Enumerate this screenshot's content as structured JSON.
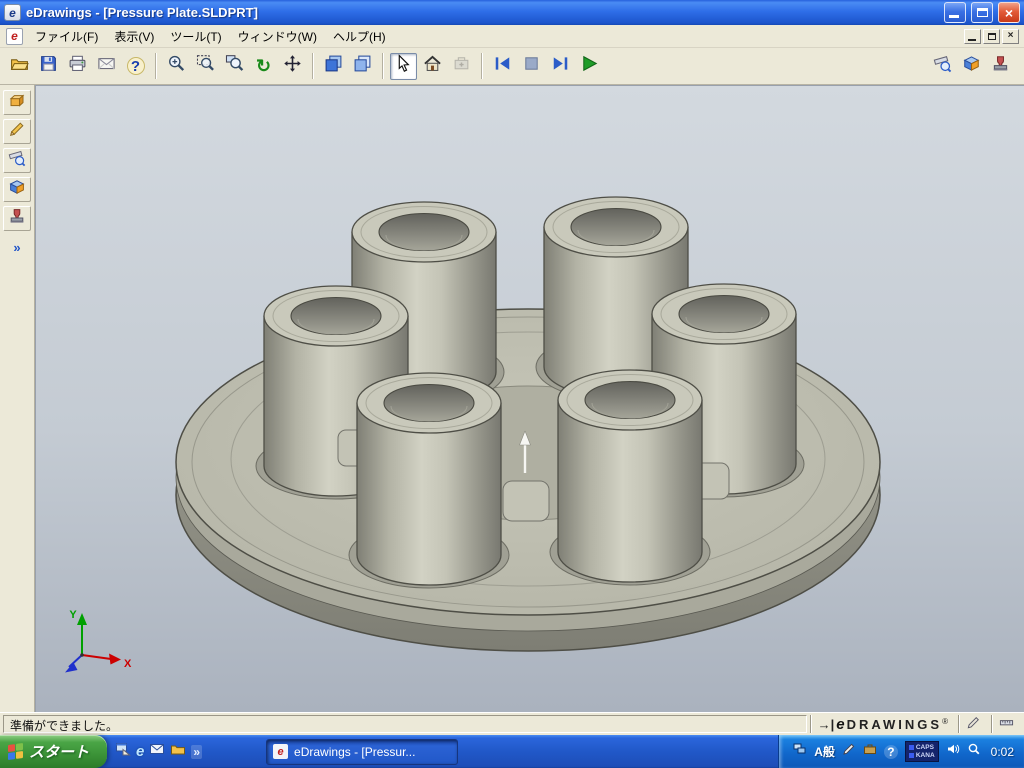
{
  "window": {
    "title": "eDrawings - [Pressure Plate.SLDPRT]"
  },
  "menubar": {
    "items": [
      {
        "label": "ファイル(F)"
      },
      {
        "label": "表示(V)"
      },
      {
        "label": "ツール(T)"
      },
      {
        "label": "ウィンドウ(W)"
      },
      {
        "label": "ヘルプ(H)"
      }
    ]
  },
  "toolbar": {
    "buttons": [
      "open",
      "save",
      "print",
      "send-email",
      "help",
      "zoom",
      "zoom-to-fit",
      "zoom-area",
      "rotate",
      "pan",
      "shaded-view",
      "wireframe-view",
      "select",
      "home-view",
      "move-component",
      "previous-view",
      "stop-animation",
      "next-view",
      "play-animation",
      "measure",
      "section",
      "stamp"
    ]
  },
  "sidebar": {
    "buttons": [
      "components",
      "markup",
      "measure",
      "section",
      "stamp",
      "expand"
    ]
  },
  "viewport": {
    "triad": {
      "x_label": "X",
      "y_label": "Y"
    }
  },
  "statusbar": {
    "message": "準備ができました。",
    "brand": {
      "arrow": "→|",
      "e": "e",
      "name": "DRAWINGS",
      "reg": "®"
    }
  },
  "taskbar": {
    "start_label": "スタート",
    "quick_launch_overflow": "»",
    "task_button_label": "eDrawings - [Pressur...",
    "tray": {
      "ime_mode": "A般",
      "caps": "CAPS",
      "kana": "KANA",
      "clock": "0:02"
    }
  },
  "glyphs": {
    "e": "e",
    "help": "?",
    "rotate": "↻",
    "question": "?",
    "close": "×",
    "chevron": "»"
  },
  "colors": {
    "titlebar_blue": "#2f6ee8",
    "chrome_gray": "#ece9d8",
    "viewport_top": "#d3d9df",
    "viewport_bottom": "#aab2be",
    "model_light": "#c9c9bb",
    "model_mid": "#b2b2a4",
    "model_dark": "#7f7f75",
    "model_outline": "#4e4e46",
    "taskbar_blue": "#2158c8",
    "start_green": "#3d9539",
    "tray_blue": "#1168cc",
    "triad_x_red": "#cc0000",
    "triad_y_green": "#00a000",
    "triad_z_blue": "#2030cc"
  }
}
